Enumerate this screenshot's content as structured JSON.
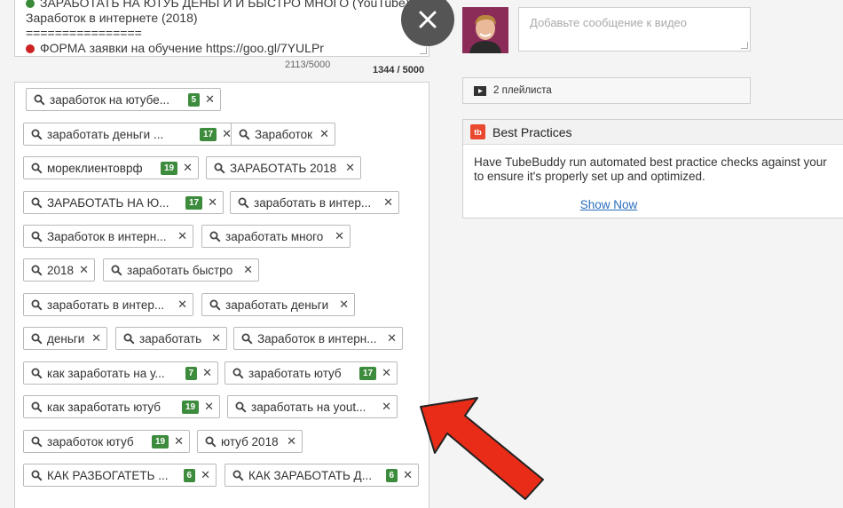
{
  "description": {
    "lines": [
      "ЗАРАБОТАТЬ НА ЮТУБ ДЕНЬГИ И БЫСТРО МНОГО (YouTube).",
      "Заработок в интернете (2018)",
      "================",
      "ФОРМА заявки на обучение https://goo.gl/7YULPr"
    ],
    "char_count": "2113/5000"
  },
  "tags_count": "1344 / 5000",
  "tags": [
    {
      "text": "заработок на ютубе...",
      "badge": "5"
    },
    {
      "text": "заработать деньги ...",
      "badge": "17"
    },
    {
      "text": "Заработок",
      "badge": ""
    },
    {
      "text": "мореклиентоврф",
      "badge": "19"
    },
    {
      "text": "ЗАРАБОТАТЬ 2018",
      "badge": ""
    },
    {
      "text": "ЗАРАБОТАТЬ НА Ю...",
      "badge": "17"
    },
    {
      "text": "заработать в интер...",
      "badge": ""
    },
    {
      "text": "Заработок в интерн...",
      "badge": ""
    },
    {
      "text": "заработать много",
      "badge": ""
    },
    {
      "text": "2018",
      "badge": ""
    },
    {
      "text": "заработать быстро",
      "badge": ""
    },
    {
      "text": "заработать в интер...",
      "badge": ""
    },
    {
      "text": "заработать деньги",
      "badge": ""
    },
    {
      "text": "деньги",
      "badge": ""
    },
    {
      "text": "заработать",
      "badge": ""
    },
    {
      "text": "Заработок в интерн...",
      "badge": ""
    },
    {
      "text": "как заработать на у...",
      "badge": "7"
    },
    {
      "text": "заработать ютуб",
      "badge": "17"
    },
    {
      "text": "как заработать ютуб",
      "badge": "19"
    },
    {
      "text": "заработать на yout...",
      "badge": ""
    },
    {
      "text": "заработок ютуб",
      "badge": "19"
    },
    {
      "text": "ютуб 2018",
      "badge": ""
    },
    {
      "text": "КАК РАЗБОГАТЕТЬ ...",
      "badge": "6"
    },
    {
      "text": "КАК ЗАРАБОТАТЬ Д...",
      "badge": "6"
    }
  ],
  "comment": {
    "placeholder": "Добавьте сообщение к видео"
  },
  "playlists": {
    "label": "2 плейлиста"
  },
  "best_practices": {
    "icon_text": "tb",
    "title": "Best Practices",
    "body_line1": "Have TubeBuddy run automated best practice checks against your",
    "body_line2": "to ensure it's properly set up and optimized.",
    "link": "Show Now"
  },
  "colors": {
    "badge": "#3d8b3d",
    "arrow": "#e82c17",
    "tubebuddy": "#e8492f",
    "link": "#2a6ebb"
  }
}
